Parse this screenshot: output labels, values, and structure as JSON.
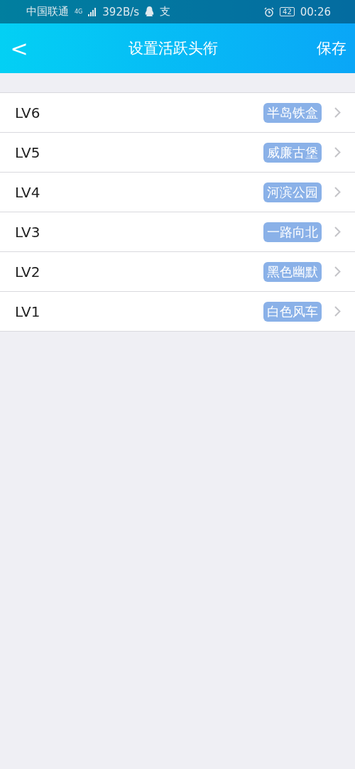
{
  "status_bar": {
    "carrier": "中国联通",
    "network": "4G",
    "speed": "392B/s",
    "app_badge": "支",
    "battery": "42",
    "time": "00:26"
  },
  "nav_bar": {
    "back": "<",
    "title": "设置活跃头衔",
    "action": "保存"
  },
  "levels": [
    {
      "level": "LV6",
      "title": "半岛铁盒"
    },
    {
      "level": "LV5",
      "title": "威廉古堡"
    },
    {
      "level": "LV4",
      "title": "河滨公园"
    },
    {
      "level": "LV3",
      "title": "一路向北"
    },
    {
      "level": "LV2",
      "title": "黑色幽默"
    },
    {
      "level": "LV1",
      "title": "白色风车"
    }
  ]
}
